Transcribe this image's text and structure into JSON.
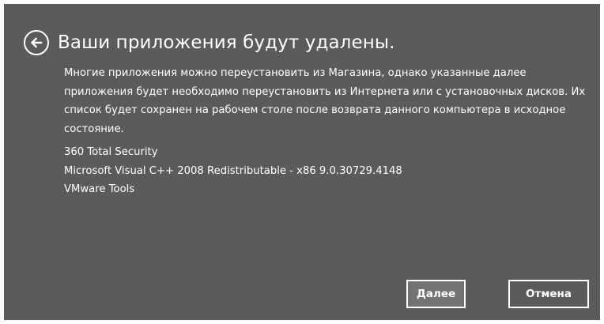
{
  "dialog": {
    "title": "Ваши приложения будут удалены.",
    "description": "Многие приложения можно переустановить из Магазина, однако указанные далее приложения будет необходимо переустановить из Интернета или с установочных дисков. Их список будет сохранен на рабочем столе после возврата данного компьютера в исходное состояние.",
    "apps": [
      "360 Total Security",
      "Microsoft Visual C++ 2008 Redistributable - x86 9.0.30729.4148",
      "VMware Tools"
    ],
    "next_label": "Далее",
    "cancel_label": "Отмена"
  },
  "icons": {
    "back": "back-arrow-circle-icon"
  },
  "colors": {
    "background": "#5b5b5b",
    "next_button": "#737373",
    "text": "#ffffff"
  }
}
